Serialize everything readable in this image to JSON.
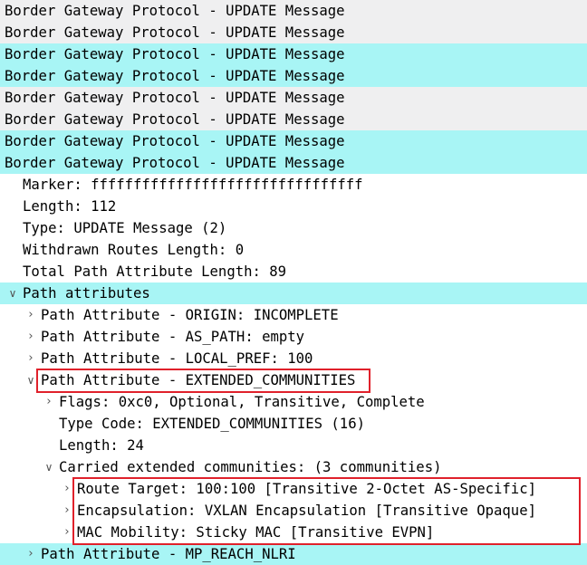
{
  "colors": {
    "gray_row": "#efeff0",
    "cyan_row": "#a8f5f5",
    "text": "#000000",
    "highlight_box": "#e0212b"
  },
  "rows": [
    {
      "text": "Border Gateway Protocol - UPDATE Message",
      "bg": "gray",
      "indent": 0,
      "arrow": "none"
    },
    {
      "text": "Border Gateway Protocol - UPDATE Message",
      "bg": "gray",
      "indent": 0,
      "arrow": "none"
    },
    {
      "text": "Border Gateway Protocol - UPDATE Message",
      "bg": "cyan",
      "indent": 0,
      "arrow": "none"
    },
    {
      "text": "Border Gateway Protocol - UPDATE Message",
      "bg": "cyan",
      "indent": 0,
      "arrow": "none"
    },
    {
      "text": "Border Gateway Protocol - UPDATE Message",
      "bg": "gray",
      "indent": 0,
      "arrow": "none"
    },
    {
      "text": "Border Gateway Protocol - UPDATE Message",
      "bg": "gray",
      "indent": 0,
      "arrow": "none"
    },
    {
      "text": "Border Gateway Protocol - UPDATE Message",
      "bg": "cyan",
      "indent": 0,
      "arrow": "none"
    },
    {
      "text": "Border Gateway Protocol - UPDATE Message",
      "bg": "cyan",
      "indent": 0,
      "arrow": "none"
    },
    {
      "text": "Marker: ffffffffffffffffffffffffffffffff",
      "bg": "white",
      "indent": 1,
      "arrow": "none"
    },
    {
      "text": "Length: 112",
      "bg": "white",
      "indent": 1,
      "arrow": "none"
    },
    {
      "text": "Type: UPDATE Message (2)",
      "bg": "white",
      "indent": 1,
      "arrow": "none"
    },
    {
      "text": "Withdrawn Routes Length: 0",
      "bg": "white",
      "indent": 1,
      "arrow": "none"
    },
    {
      "text": "Total Path Attribute Length: 89",
      "bg": "white",
      "indent": 1,
      "arrow": "none"
    },
    {
      "text": "Path attributes",
      "bg": "cyan",
      "indent": 1,
      "arrow": "expanded"
    },
    {
      "text": "Path Attribute - ORIGIN: INCOMPLETE",
      "bg": "white",
      "indent": 2,
      "arrow": "collapsed"
    },
    {
      "text": "Path Attribute - AS_PATH: empty",
      "bg": "white",
      "indent": 2,
      "arrow": "collapsed"
    },
    {
      "text": "Path Attribute - LOCAL_PREF: 100",
      "bg": "white",
      "indent": 2,
      "arrow": "collapsed"
    },
    {
      "text": "Path Attribute - EXTENDED_COMMUNITIES",
      "bg": "white",
      "indent": 2,
      "arrow": "expanded"
    },
    {
      "text": "Flags: 0xc0, Optional, Transitive, Complete",
      "bg": "white",
      "indent": 3,
      "arrow": "collapsed"
    },
    {
      "text": "Type Code: EXTENDED_COMMUNITIES (16)",
      "bg": "white",
      "indent": 3,
      "arrow": "none"
    },
    {
      "text": "Length: 24",
      "bg": "white",
      "indent": 3,
      "arrow": "none"
    },
    {
      "text": "Carried extended communities: (3 communities)",
      "bg": "white",
      "indent": 3,
      "arrow": "expanded"
    },
    {
      "text": "Route Target: 100:100 [Transitive 2-Octet AS-Specific]",
      "bg": "white",
      "indent": 4,
      "arrow": "collapsed"
    },
    {
      "text": "Encapsulation: VXLAN Encapsulation [Transitive Opaque]",
      "bg": "white",
      "indent": 4,
      "arrow": "collapsed"
    },
    {
      "text": "MAC Mobility: Sticky MAC [Transitive EVPN]",
      "bg": "white",
      "indent": 4,
      "arrow": "collapsed"
    },
    {
      "text": "Path Attribute - MP_REACH_NLRI",
      "bg": "cyan",
      "indent": 2,
      "arrow": "collapsed"
    }
  ],
  "highlights": [
    {
      "name": "extended-communities-highlight",
      "first_row": 17,
      "last_row": 17
    },
    {
      "name": "communities-list-highlight",
      "first_row": 22,
      "last_row": 24
    }
  ]
}
